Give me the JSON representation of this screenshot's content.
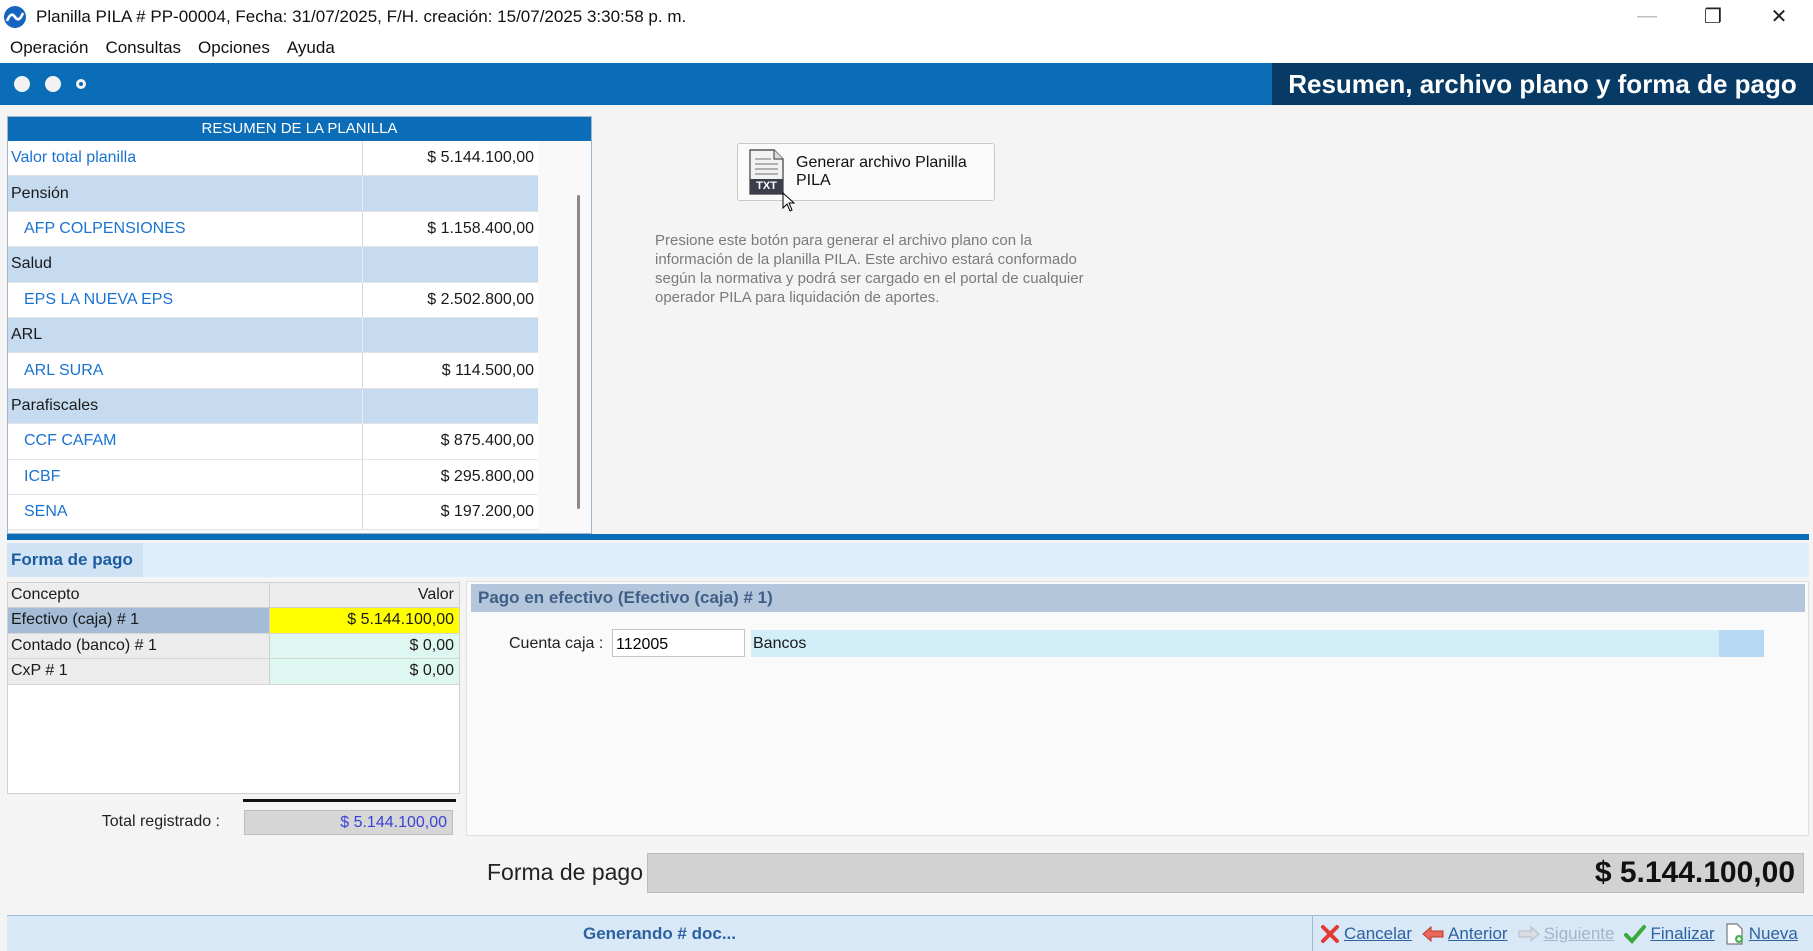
{
  "window": {
    "title": "Planilla PILA # PP-00004, Fecha: 31/07/2025, F/H. creación: 15/07/2025 3:30:58 p. m.",
    "minimize": "—",
    "maximize": "❐",
    "close": "✕"
  },
  "menu": [
    "Operación",
    "Consultas",
    "Opciones",
    "Ayuda"
  ],
  "band": {
    "section_title": "Resumen, archivo plano y forma de pago"
  },
  "summary": {
    "header": "RESUMEN DE LA PLANILLA",
    "rows": [
      {
        "label": "Valor total planilla",
        "value": "$ 5.144.100,00",
        "kind": "item"
      },
      {
        "label": "Pensión",
        "value": "",
        "kind": "group"
      },
      {
        "label": "AFP COLPENSIONES",
        "value": "$ 1.158.400,00",
        "kind": "sub"
      },
      {
        "label": "Salud",
        "value": "",
        "kind": "group"
      },
      {
        "label": "EPS LA NUEVA EPS",
        "value": "$ 2.502.800,00",
        "kind": "sub"
      },
      {
        "label": "ARL",
        "value": "",
        "kind": "group"
      },
      {
        "label": "ARL SURA",
        "value": "$ 114.500,00",
        "kind": "sub"
      },
      {
        "label": "Parafiscales",
        "value": "",
        "kind": "group"
      },
      {
        "label": "CCF CAFAM",
        "value": "$ 875.400,00",
        "kind": "sub"
      },
      {
        "label": "ICBF",
        "value": "$ 295.800,00",
        "kind": "sub"
      },
      {
        "label": "SENA",
        "value": "$ 197.200,00",
        "kind": "sub"
      }
    ]
  },
  "generate": {
    "button_label": "Generar archivo Planilla PILA",
    "icon_text": "TXT",
    "help_text": "Presione este botón para generar el archivo plano con la información de la planilla PILA. Este archivo estará conformado según la normativa y podrá ser cargado en el portal de cualquier operador PILA para liquidación de aportes."
  },
  "forma_pago": {
    "tab_label": "Forma de pago",
    "columns": [
      "Concepto",
      "Valor"
    ],
    "rows": [
      {
        "concepto": "Efectivo (caja) # 1",
        "valor": "$ 5.144.100,00",
        "selected": true
      },
      {
        "concepto": "Contado (banco) # 1",
        "valor": "$ 0,00",
        "selected": false
      },
      {
        "concepto": "CxP # 1",
        "valor": "$ 0,00",
        "selected": false
      }
    ],
    "total_label": "Total registrado :",
    "total_value": "$ 5.144.100,00",
    "detail": {
      "header": "Pago en efectivo (Efectivo (caja) # 1)",
      "cuenta_label": "Cuenta caja :",
      "cuenta_value": "112005",
      "cuenta_desc": "Bancos"
    },
    "grand_label": "Forma de pago",
    "grand_value": "$ 5.144.100,00"
  },
  "statusbar": {
    "status": "Generando # doc...",
    "actions": {
      "cancel": "Cancelar",
      "prev": "Anterior",
      "next": "Siguiente",
      "finish": "Finalizar",
      "new": "Nueva"
    }
  },
  "colors": {
    "accent": "#0b6cb8",
    "dark_band": "#073a64",
    "selected_value": "#ffff00",
    "link": "#1a73d0"
  }
}
